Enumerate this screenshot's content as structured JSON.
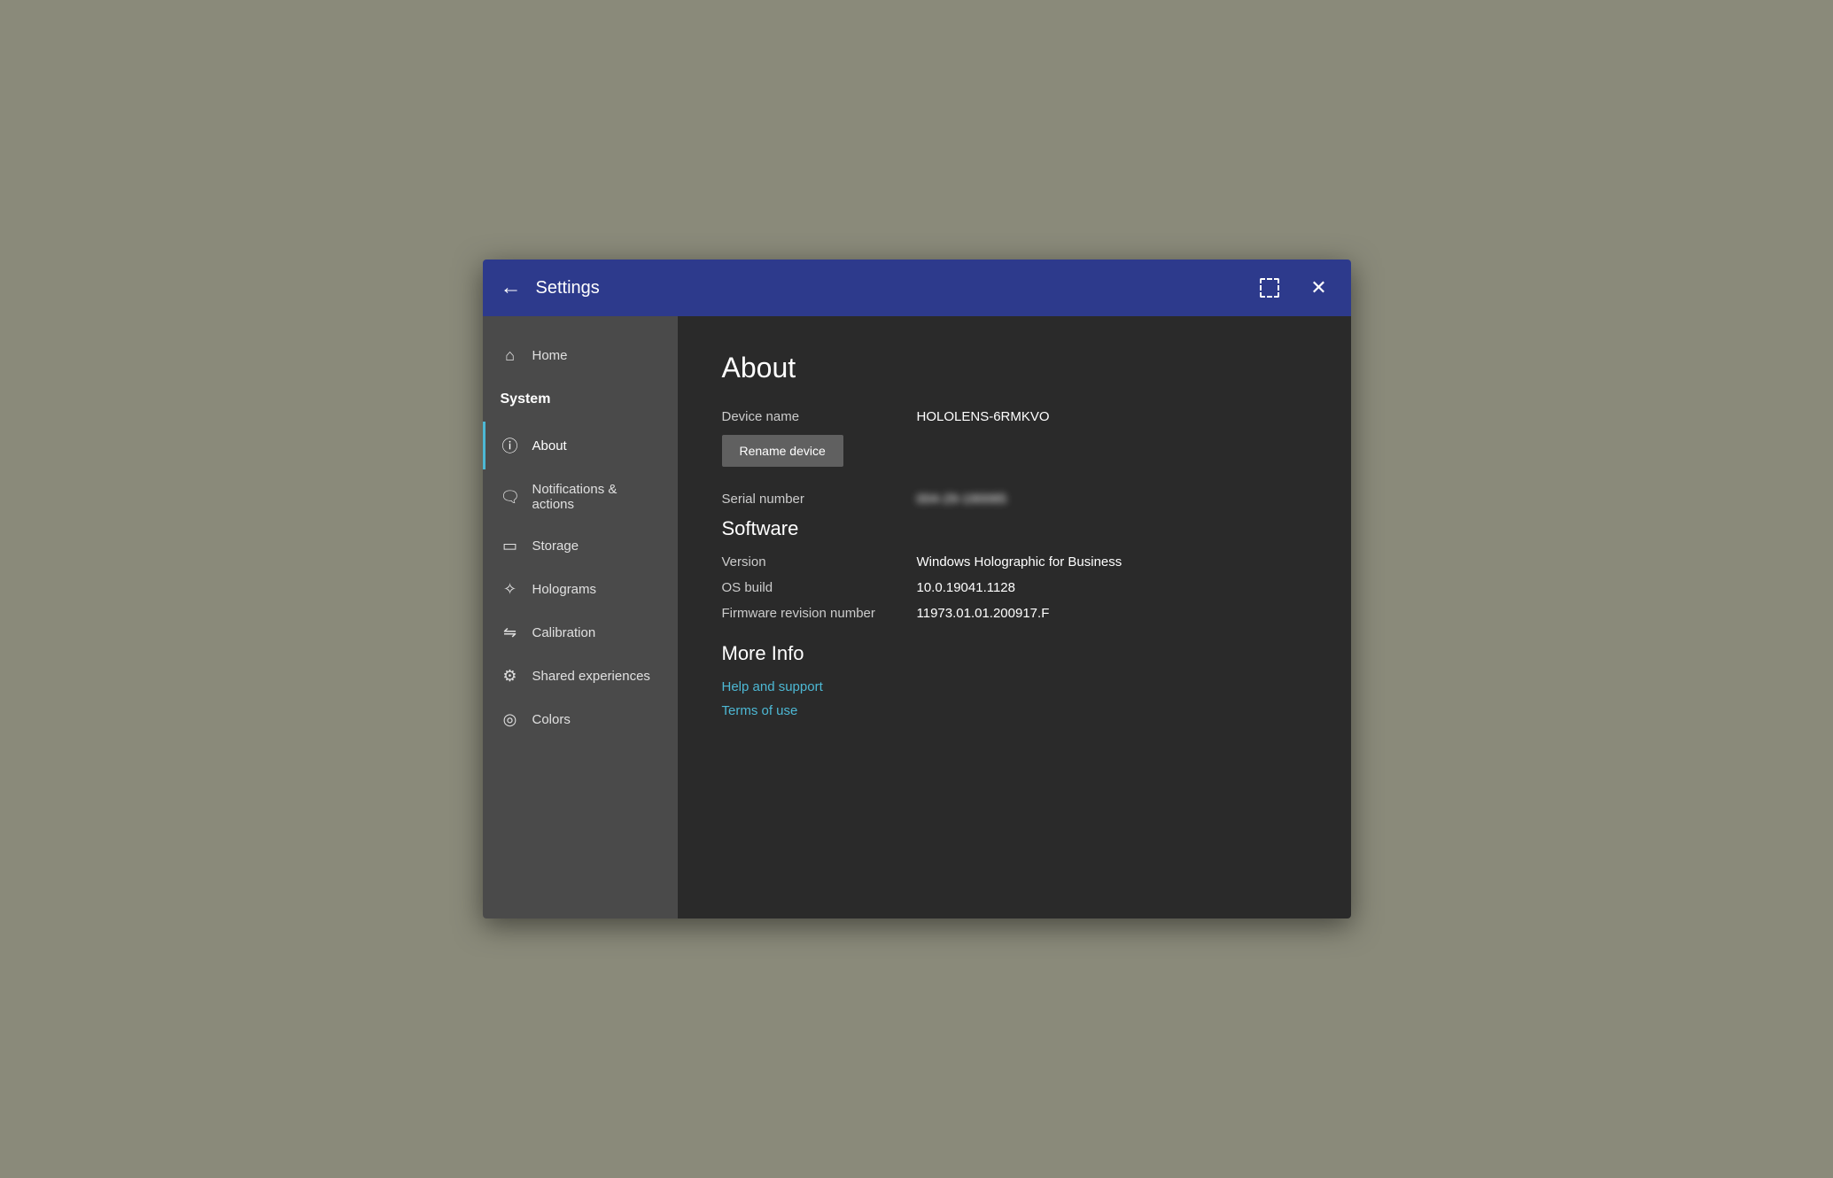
{
  "titlebar": {
    "back_label": "←",
    "title": "Settings",
    "snap_label": "⧉",
    "close_label": "✕"
  },
  "sidebar": {
    "home_label": "Home",
    "system_label": "System",
    "items": [
      {
        "id": "about",
        "label": "About",
        "icon": "ℹ",
        "active": true
      },
      {
        "id": "notifications",
        "label": "Notifications & actions",
        "icon": "🖵",
        "active": false
      },
      {
        "id": "storage",
        "label": "Storage",
        "icon": "⊟",
        "active": false
      },
      {
        "id": "holograms",
        "label": "Holograms",
        "icon": "✦",
        "active": false
      },
      {
        "id": "calibration",
        "label": "Calibration",
        "icon": "⇌",
        "active": false
      },
      {
        "id": "shared",
        "label": "Shared experiences",
        "icon": "⚙",
        "active": false
      },
      {
        "id": "colors",
        "label": "Colors",
        "icon": "◎",
        "active": false
      }
    ]
  },
  "main": {
    "page_title": "About",
    "device_name_label": "Device name",
    "device_name_value": "HOLOLENS-6RMKVO",
    "rename_button": "Rename device",
    "serial_number_label": "Serial number",
    "serial_number_value": "004-29-190065",
    "software_title": "Software",
    "version_label": "Version",
    "version_value": "Windows Holographic for Business",
    "os_build_label": "OS build",
    "os_build_value": "10.0.19041.1128",
    "firmware_label": "Firmware revision number",
    "firmware_value": "11973.01.01.200917.F",
    "more_info_title": "More Info",
    "help_link": "Help and support",
    "terms_link": "Terms of use"
  }
}
